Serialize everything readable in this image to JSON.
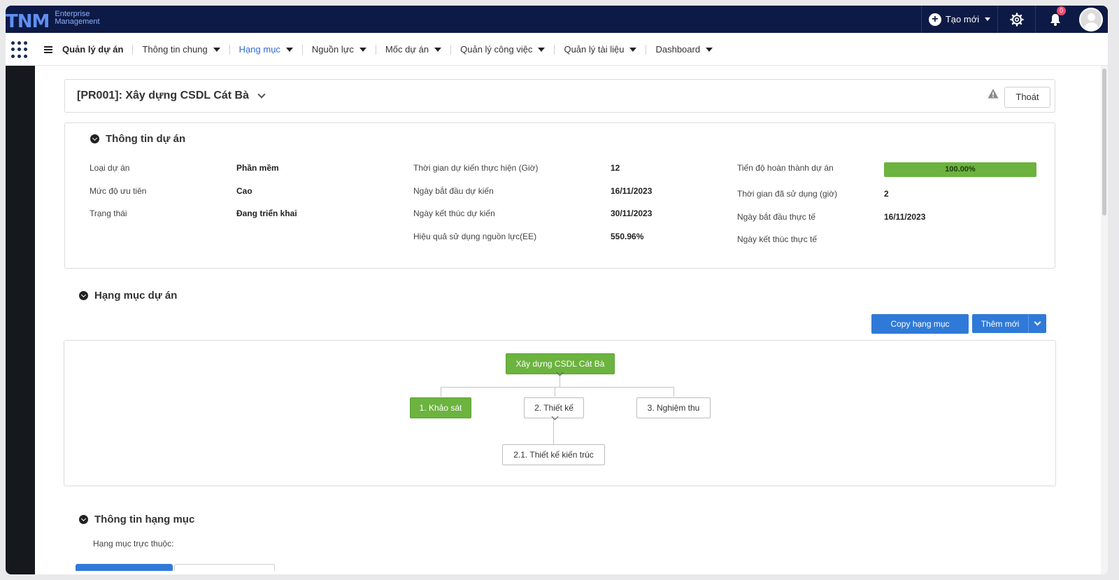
{
  "brand": {
    "mark": "TNM",
    "line1": "Enterprise",
    "line2": "Management"
  },
  "topbar": {
    "create_label": "Tạo mới",
    "notification_count": "0"
  },
  "nav": {
    "title": "Quản lý dự án",
    "items": [
      {
        "label": "Thông tin chung",
        "active": false
      },
      {
        "label": "Hạng mục",
        "active": true
      },
      {
        "label": "Nguồn lực",
        "active": false
      },
      {
        "label": "Mốc dự án",
        "active": false
      },
      {
        "label": "Quản lý công việc",
        "active": false
      },
      {
        "label": "Quản lý tài liệu",
        "active": false
      },
      {
        "label": "Dashboard",
        "active": false
      }
    ]
  },
  "project": {
    "title": "[PR001]: Xây dựng CSDL Cát Bà",
    "exit_label": "Thoát"
  },
  "info": {
    "heading": "Thông tin dự án",
    "col1": [
      {
        "label": "Loại dự án",
        "value": "Phần mềm"
      },
      {
        "label": "Mức độ ưu tiên",
        "value": "Cao"
      },
      {
        "label": "Trạng thái",
        "value": "Đang triển khai"
      }
    ],
    "col2": [
      {
        "label": "Thời gian dự kiến thực hiện (Giờ)",
        "value": "12"
      },
      {
        "label": "Ngày bắt đầu dự kiến",
        "value": "16/11/2023"
      },
      {
        "label": "Ngày kết thúc dự kiến",
        "value": "30/11/2023"
      },
      {
        "label": "Hiệu quả sử dụng nguồn lực(EE)",
        "value": "550.96%"
      }
    ],
    "col3": [
      {
        "label": "Tiến độ hoàn thành dự án",
        "value": "100.00%"
      },
      {
        "label": "Thời gian đã sử dụng (giờ)",
        "value": "2"
      },
      {
        "label": "Ngày bắt đầu thực tế",
        "value": "16/11/2023"
      },
      {
        "label": "Ngày kết thúc thực tế",
        "value": ""
      }
    ],
    "progress_percent": 100
  },
  "categories": {
    "heading": "Hạng mục dự án",
    "copy_label": "Copy hạng mục",
    "add_label": "Thêm mới",
    "tree": {
      "root": "Xây dựng CSDL Cát Bà",
      "children": [
        "1. Khảo sát",
        "2. Thiết kế",
        "3. Nghiệm thu"
      ],
      "grandchild": "2.1. Thiết kế kiến trúc"
    }
  },
  "detail": {
    "heading": "Thông tin hạng mục",
    "parent_label": "Hạng mục trực thuộc:"
  },
  "colors": {
    "topbar": "#0d1a45",
    "accent": "#2f7ad8",
    "green": "#6cb33f",
    "active_nav": "#2f6bd3"
  }
}
